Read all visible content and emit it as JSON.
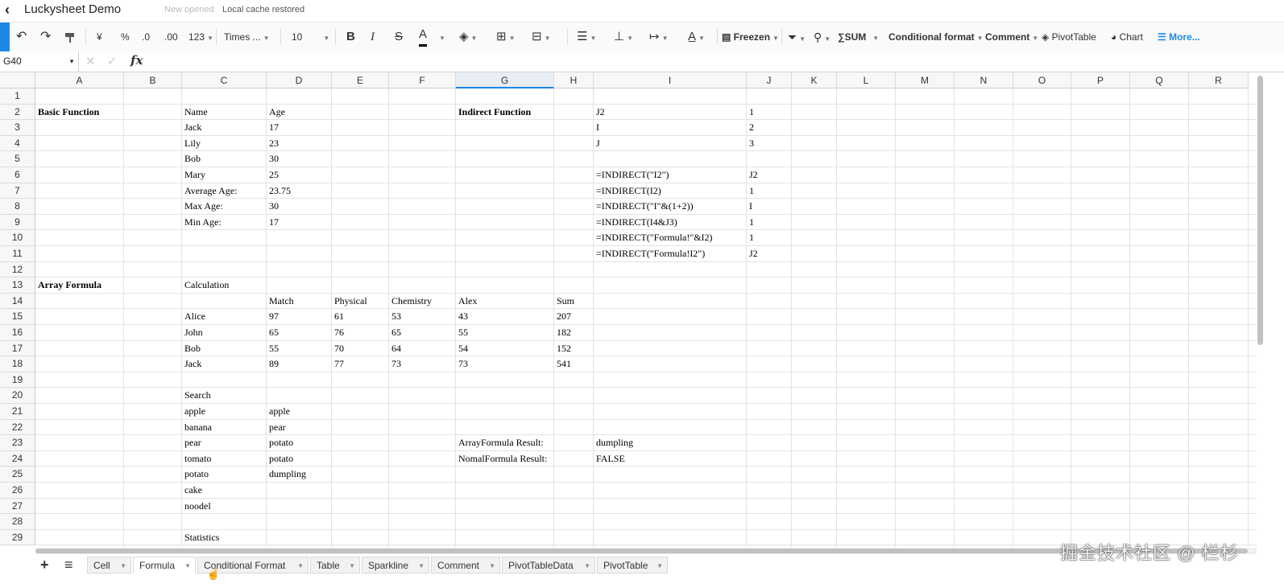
{
  "titlebar": {
    "back_glyph": "‹",
    "title": "Luckysheet Demo",
    "status_new": "New opened",
    "status_cache": "Local cache restored"
  },
  "toolbar": {
    "currency": "¥",
    "percent": "%",
    "dec_decrease": ".0",
    "dec_increase": ".00",
    "number_format": "123",
    "font_family": "Times ...",
    "font_size": "10",
    "bold": "B",
    "italic": "I",
    "strike": "S",
    "font_color": "A",
    "freeze": "Freezen",
    "sum": "SUM",
    "conditional_format": "Conditional format",
    "comment": "Comment",
    "pivot_table": "PivotTable",
    "chart": "Chart",
    "more": "More..."
  },
  "formula_bar": {
    "cell_ref": "G40",
    "cancel_glyph": "✕",
    "confirm_glyph": "✓",
    "fx": "fx"
  },
  "grid": {
    "columns": [
      "A",
      "B",
      "C",
      "D",
      "E",
      "F",
      "G",
      "H",
      "I",
      "J",
      "K",
      "L",
      "M",
      "N",
      "O",
      "P",
      "Q",
      "R"
    ],
    "selected_column": "G",
    "rows": [
      "1",
      "2",
      "3",
      "4",
      "5",
      "6",
      "7",
      "8",
      "9",
      "10",
      "11",
      "12",
      "13",
      "14",
      "15",
      "16",
      "17",
      "18",
      "19",
      "20",
      "21",
      "22",
      "23",
      "24",
      "25",
      "26",
      "27",
      "28",
      "29"
    ],
    "cells": [
      {
        "col": "A",
        "row": 2,
        "v": "Basic Function",
        "bold": true
      },
      {
        "col": "C",
        "row": 2,
        "v": "Name"
      },
      {
        "col": "D",
        "row": 2,
        "v": "Age"
      },
      {
        "col": "G",
        "row": 2,
        "v": "Indirect Function",
        "bold": true
      },
      {
        "col": "I",
        "row": 2,
        "v": "J2"
      },
      {
        "col": "J",
        "row": 2,
        "v": "1"
      },
      {
        "col": "C",
        "row": 3,
        "v": "Jack"
      },
      {
        "col": "D",
        "row": 3,
        "v": "17"
      },
      {
        "col": "I",
        "row": 3,
        "v": "I"
      },
      {
        "col": "J",
        "row": 3,
        "v": "2"
      },
      {
        "col": "C",
        "row": 4,
        "v": "Lily"
      },
      {
        "col": "D",
        "row": 4,
        "v": "23"
      },
      {
        "col": "I",
        "row": 4,
        "v": "J"
      },
      {
        "col": "J",
        "row": 4,
        "v": "3"
      },
      {
        "col": "C",
        "row": 5,
        "v": "Bob"
      },
      {
        "col": "D",
        "row": 5,
        "v": "30"
      },
      {
        "col": "C",
        "row": 6,
        "v": "Mary"
      },
      {
        "col": "D",
        "row": 6,
        "v": "25"
      },
      {
        "col": "I",
        "row": 6,
        "v": "=INDIRECT(\"I2\")"
      },
      {
        "col": "J",
        "row": 6,
        "v": "J2"
      },
      {
        "col": "C",
        "row": 7,
        "v": "Average Age:"
      },
      {
        "col": "D",
        "row": 7,
        "v": "23.75"
      },
      {
        "col": "I",
        "row": 7,
        "v": "=INDIRECT(I2)"
      },
      {
        "col": "J",
        "row": 7,
        "v": "1"
      },
      {
        "col": "C",
        "row": 8,
        "v": "Max Age:"
      },
      {
        "col": "D",
        "row": 8,
        "v": "30"
      },
      {
        "col": "I",
        "row": 8,
        "v": "=INDIRECT(\"I\"&(1+2))"
      },
      {
        "col": "J",
        "row": 8,
        "v": "I"
      },
      {
        "col": "C",
        "row": 9,
        "v": "Min Age:"
      },
      {
        "col": "D",
        "row": 9,
        "v": "17"
      },
      {
        "col": "I",
        "row": 9,
        "v": "=INDIRECT(I4&J3)"
      },
      {
        "col": "J",
        "row": 9,
        "v": "1"
      },
      {
        "col": "I",
        "row": 10,
        "v": "=INDIRECT(\"Formula!\"&I2)"
      },
      {
        "col": "J",
        "row": 10,
        "v": "1"
      },
      {
        "col": "I",
        "row": 11,
        "v": "=INDIRECT(\"Formula!I2\")"
      },
      {
        "col": "J",
        "row": 11,
        "v": "J2"
      },
      {
        "col": "A",
        "row": 13,
        "v": "Array Formula",
        "bold": true
      },
      {
        "col": "C",
        "row": 13,
        "v": "Calculation"
      },
      {
        "col": "D",
        "row": 14,
        "v": "Match"
      },
      {
        "col": "E",
        "row": 14,
        "v": "Physical"
      },
      {
        "col": "F",
        "row": 14,
        "v": "Chemistry"
      },
      {
        "col": "G",
        "row": 14,
        "v": "Alex"
      },
      {
        "col": "H",
        "row": 14,
        "v": "Sum"
      },
      {
        "col": "C",
        "row": 15,
        "v": "Alice"
      },
      {
        "col": "D",
        "row": 15,
        "v": "97"
      },
      {
        "col": "E",
        "row": 15,
        "v": "61"
      },
      {
        "col": "F",
        "row": 15,
        "v": "53"
      },
      {
        "col": "G",
        "row": 15,
        "v": "43"
      },
      {
        "col": "H",
        "row": 15,
        "v": "207"
      },
      {
        "col": "C",
        "row": 16,
        "v": "John"
      },
      {
        "col": "D",
        "row": 16,
        "v": "65"
      },
      {
        "col": "E",
        "row": 16,
        "v": "76"
      },
      {
        "col": "F",
        "row": 16,
        "v": "65"
      },
      {
        "col": "G",
        "row": 16,
        "v": "55"
      },
      {
        "col": "H",
        "row": 16,
        "v": "182"
      },
      {
        "col": "C",
        "row": 17,
        "v": "Bob"
      },
      {
        "col": "D",
        "row": 17,
        "v": "55"
      },
      {
        "col": "E",
        "row": 17,
        "v": "70"
      },
      {
        "col": "F",
        "row": 17,
        "v": "64"
      },
      {
        "col": "G",
        "row": 17,
        "v": "54"
      },
      {
        "col": "H",
        "row": 17,
        "v": "152"
      },
      {
        "col": "C",
        "row": 18,
        "v": "Jack"
      },
      {
        "col": "D",
        "row": 18,
        "v": "89"
      },
      {
        "col": "E",
        "row": 18,
        "v": "77"
      },
      {
        "col": "F",
        "row": 18,
        "v": "73"
      },
      {
        "col": "G",
        "row": 18,
        "v": "73"
      },
      {
        "col": "H",
        "row": 18,
        "v": "541"
      },
      {
        "col": "C",
        "row": 20,
        "v": "Search"
      },
      {
        "col": "C",
        "row": 21,
        "v": "apple"
      },
      {
        "col": "D",
        "row": 21,
        "v": "apple"
      },
      {
        "col": "C",
        "row": 22,
        "v": "banana"
      },
      {
        "col": "D",
        "row": 22,
        "v": "pear"
      },
      {
        "col": "C",
        "row": 23,
        "v": "pear"
      },
      {
        "col": "D",
        "row": 23,
        "v": "potato"
      },
      {
        "col": "G",
        "row": 23,
        "v": "ArrayFormula Result:"
      },
      {
        "col": "I",
        "row": 23,
        "v": "dumpling"
      },
      {
        "col": "C",
        "row": 24,
        "v": "tomato"
      },
      {
        "col": "D",
        "row": 24,
        "v": "potato"
      },
      {
        "col": "G",
        "row": 24,
        "v": "NomalFormula Result:"
      },
      {
        "col": "I",
        "row": 24,
        "v": "FALSE"
      },
      {
        "col": "C",
        "row": 25,
        "v": "potato"
      },
      {
        "col": "D",
        "row": 25,
        "v": "dumpling"
      },
      {
        "col": "C",
        "row": 26,
        "v": "cake"
      },
      {
        "col": "C",
        "row": 27,
        "v": "noodel"
      },
      {
        "col": "C",
        "row": 29,
        "v": "Statistics"
      }
    ]
  },
  "sheets": {
    "active": "Formula",
    "tabs": [
      "Cell",
      "Formula",
      "Conditional Format",
      "Table",
      "Sparkline",
      "Comment",
      "PivotTableData",
      "PivotTable"
    ]
  },
  "watermark": "掘金技术社区 @ 栏杉",
  "colors": {
    "accent": "#1e88e5",
    "grid_line": "#e3e3e3",
    "header_bg": "#f7f7f7"
  }
}
